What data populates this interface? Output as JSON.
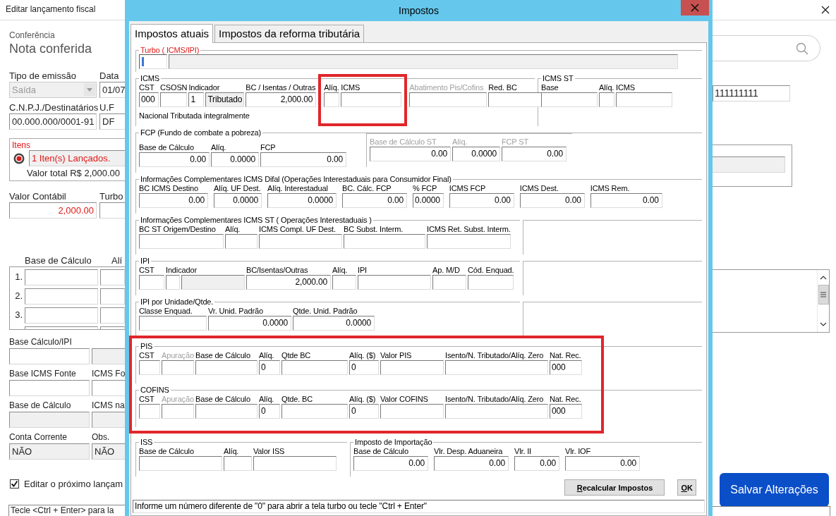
{
  "main_window": {
    "title": "Editar lançamento fiscal",
    "caption": "Conferência",
    "heading": "Nota conferida",
    "left_blocks": [
      {
        "kind": "fields",
        "fields": [
          {
            "label": "Tipo de emissão",
            "value": "Saída",
            "kind": "select"
          },
          {
            "label": "Data",
            "value": "01/07",
            "kind": "edit"
          }
        ]
      },
      {
        "kind": "fields",
        "fields": [
          {
            "label": "C.N.P.J./Destinatários",
            "value": "00.000.000/0001-91",
            "kind": "edit"
          },
          {
            "label": "U.F",
            "value": "DF",
            "kind": "edit"
          }
        ]
      },
      {
        "kind": "items",
        "title": "Itens",
        "summary": "1 Iten(s) Lançados.",
        "total": "Valor total R$ 2,000.00"
      },
      {
        "kind": "fields",
        "fields": [
          {
            "label": "Valor Contábil",
            "value": "2,000.00",
            "kind": "alert"
          },
          {
            "label": "Turbo",
            "kind": "edit"
          }
        ]
      },
      {
        "kind": "grid",
        "columns": [
          "Base de Cálculo",
          "Alí"
        ],
        "rows": [
          "1.",
          "2.",
          "3."
        ]
      },
      {
        "kind": "fields",
        "fields": [
          {
            "label": "Base Cálculo/IPI",
            "kind": "edit"
          },
          {
            "kind": "readonly"
          }
        ]
      },
      {
        "kind": "fields",
        "fields": [
          {
            "label": "Base ICMS Fonte",
            "kind": "edit"
          },
          {
            "label": "ICMS Fo",
            "kind": "edit"
          }
        ]
      },
      {
        "kind": "fields",
        "fields": [
          {
            "label": "Base de Cálculo",
            "kind": "readonly"
          },
          {
            "label": "ICMS na",
            "kind": "readonly"
          }
        ]
      },
      {
        "kind": "fields",
        "fields": [
          {
            "label": "Conta Corrente",
            "value": "NÃO",
            "kind": "readonly"
          },
          {
            "label": "Obs.",
            "value": "NÃO",
            "kind": "readonly"
          }
        ]
      }
    ],
    "next_entry": {
      "label": "Editar o próximo lançam",
      "checked": true
    },
    "hint": "Tecle <Ctrl + Enter> para la",
    "record_value": "111111111",
    "save_button": "Salvar Alterações"
  },
  "dialog": {
    "title": "Impostos",
    "tabs": [
      {
        "label": "Impostos atuais",
        "selected": true
      },
      {
        "label": "Impostos da reforma tributária",
        "selected": false
      }
    ],
    "rows": [
      {
        "highlighted": false,
        "groups": [
          {
            "kind": "turbo",
            "title": "Turbo ( ICMS/IPI)",
            "columns": [
              {
                "inputs": [
                  {
                    "kind": "focused"
                  },
                  {
                    "kind": "readonly"
                  }
                ]
              }
            ]
          }
        ]
      },
      {
        "highlighted": false,
        "groups": [
          {
            "kind": "icms",
            "title": "ICMS",
            "note": "Nacional Tributada integralmente",
            "columns": [
              {
                "label": "CST",
                "value": "000",
                "kind": "edit",
                "highlighted": false
              },
              {
                "label": "CSOSN",
                "kind": "edit",
                "highlighted": false
              },
              {
                "label": "Indicador",
                "inputs": [
                  {
                    "value": "1",
                    "kind": "edit"
                  },
                  {
                    "value": "Tributado",
                    "kind": "readonly"
                  }
                ],
                "highlighted": false
              },
              {
                "label": "BC / Isentas / Outras",
                "value": "2,000.00",
                "kind": "amount",
                "highlighted": false
              },
              {
                "label": "Alíq.",
                "kind": "edit",
                "highlighted": true
              },
              {
                "label": "ICMS",
                "kind": "edit",
                "highlighted": true
              },
              {
                "label": "Abatimento Pis/Cofins",
                "kind": "edit",
                "disabled": true,
                "highlighted": false
              },
              {
                "label": "Red. BC",
                "kind": "edit",
                "highlighted": false
              }
            ]
          },
          {
            "kind": "icms_st",
            "title": "ICMS ST",
            "columns": [
              {
                "label": "Base",
                "kind": "edit"
              },
              {
                "label": "Alíq.",
                "kind": "edit"
              },
              {
                "label": "ICMS",
                "kind": "edit"
              }
            ]
          }
        ]
      },
      {
        "highlighted": false,
        "groups": [
          {
            "kind": "fcp",
            "title": "FCP (Fundo de combate a pobreza)",
            "columns": [
              {
                "label": "Base de Cálculo",
                "value": "0.00",
                "kind": "amount"
              },
              {
                "label": "Alíq.",
                "value": "0.0000",
                "kind": "amount"
              },
              {
                "label": "FCP",
                "value": "0.00",
                "kind": "amount"
              }
            ],
            "subgroup": {
              "disabled": true,
              "columns": [
                {
                  "label": "Base de Cálculo ST",
                  "value": "0.00",
                  "kind": "amount"
                },
                {
                  "label": "Alíq.",
                  "value": "0.0000",
                  "kind": "amount"
                },
                {
                  "label": "FCP ST",
                  "value": "0.00",
                  "kind": "amount"
                }
              ]
            }
          }
        ]
      },
      {
        "highlighted": false,
        "groups": [
          {
            "kind": "difal",
            "title": "Informações Complementares ICMS Difal (Operações Interestaduais para Consumidor Final)",
            "columns": [
              {
                "label": "BC ICMS Destino",
                "value": "0.00",
                "kind": "amount"
              },
              {
                "label": "Alíq. UF Dest.",
                "value": "0.0000",
                "kind": "amount"
              },
              {
                "label": "Alíq. Interestadual",
                "value": "0.0000",
                "kind": "amount"
              },
              {
                "label": "BC. Cálc. FCP",
                "value": "0.00",
                "kind": "amount"
              },
              {
                "label": "% FCP",
                "value": "0.0000",
                "kind": "amount"
              },
              {
                "label": "ICMS FCP",
                "value": "0.00",
                "kind": "amount"
              },
              {
                "label": "ICMS Dest.",
                "value": "0.00",
                "kind": "amount"
              },
              {
                "label": "ICMS Rem.",
                "value": "0.00",
                "kind": "amount"
              }
            ]
          }
        ]
      },
      {
        "highlighted": false,
        "groups": [
          {
            "kind": "icms_st_comp",
            "title": "Informações Complementares ICMS ST ( Operações Interestaduais )",
            "columns": [
              {
                "label": "BC ST Origem/Destino",
                "kind": "edit"
              },
              {
                "label": "Alíq.",
                "kind": "edit"
              },
              {
                "label": "ICMS Compl. UF Dest.",
                "kind": "edit"
              },
              {
                "label": "BC  Subst. Interm.",
                "kind": "edit"
              },
              {
                "label": "ICMS Ret. Subst. Interm.",
                "kind": "edit"
              }
            ]
          },
          {
            "kind": "blank"
          }
        ]
      },
      {
        "highlighted": false,
        "groups": [
          {
            "kind": "ipi",
            "title": "IPI",
            "columns": [
              {
                "label": "CST",
                "kind": "edit"
              },
              {
                "label": "Indicador",
                "inputs": [
                  {
                    "kind": "edit"
                  },
                  {
                    "kind": "readonly"
                  }
                ]
              },
              {
                "label": "BC/Isentas/Outras",
                "value": "2,000.00",
                "kind": "amount"
              },
              {
                "label": "Alíq.",
                "kind": "edit"
              },
              {
                "label": "IPI",
                "kind": "edit"
              },
              {
                "label": "Ap. M/D",
                "kind": "edit"
              },
              {
                "label": "Cód. Enquad.",
                "kind": "edit"
              }
            ]
          },
          {
            "kind": "blank"
          }
        ]
      },
      {
        "highlighted": false,
        "groups": [
          {
            "kind": "ipi_qty",
            "title": "IPI por Unidade/Qtde.",
            "columns": [
              {
                "label": "Classe Enquad.",
                "kind": "edit"
              },
              {
                "label": "Vr. Unid. Padrão",
                "value": "0.0000",
                "kind": "amount"
              },
              {
                "label": "Qtde. Unid. Padrão",
                "value": "0.0000",
                "kind": "amount"
              }
            ]
          },
          {
            "kind": "blank"
          }
        ]
      },
      {
        "highlighted": true,
        "groups": [
          {
            "kind": "pis",
            "title": "PIS",
            "columns": [
              {
                "label": "CST",
                "kind": "edit"
              },
              {
                "label": "Apuração",
                "kind": "edit",
                "disabled": true
              },
              {
                "label": "Base de Cálculo",
                "kind": "edit"
              },
              {
                "label": "Alíq.",
                "value": "0",
                "kind": "edit"
              },
              {
                "label": "Qtde BC",
                "kind": "edit"
              },
              {
                "label": "Alíq. ($)",
                "value": "0",
                "kind": "edit"
              },
              {
                "label": "Valor PIS",
                "kind": "edit"
              },
              {
                "label": "Isento/N. Tributado/Alíq. Zero",
                "kind": "edit"
              },
              {
                "label": "Nat. Rec.",
                "value": "000",
                "kind": "edit"
              }
            ]
          }
        ]
      },
      {
        "highlighted": true,
        "groups": [
          {
            "kind": "cofins",
            "title": "COFINS",
            "columns": [
              {
                "label": "CST",
                "kind": "edit"
              },
              {
                "label": "Apuração",
                "kind": "edit",
                "disabled": true
              },
              {
                "label": "Base de Cálculo",
                "kind": "edit"
              },
              {
                "label": "Alíq.",
                "value": "0",
                "kind": "edit"
              },
              {
                "label": "Qtde. BC",
                "kind": "edit"
              },
              {
                "label": "Alíq. ($)",
                "value": "0",
                "kind": "edit"
              },
              {
                "label": "Valor COFINS",
                "kind": "edit"
              },
              {
                "label": "Isento/N. Tributado/Alíq. Zero",
                "kind": "edit"
              },
              {
                "label": "Nat. Rec.",
                "value": "000",
                "kind": "edit"
              }
            ]
          }
        ]
      },
      {
        "highlighted": false,
        "groups": [
          {
            "kind": "iss",
            "title": "ISS",
            "columns": [
              {
                "label": "Base de Cálculo",
                "kind": "edit"
              },
              {
                "label": "Alíq.",
                "kind": "edit"
              },
              {
                "label": "Valor ISS",
                "kind": "edit"
              }
            ]
          },
          {
            "kind": "import",
            "title": "Imposto de Importação",
            "columns": [
              {
                "label": "Base de Cálculo",
                "value": "0.00",
                "kind": "amount"
              },
              {
                "label": "Vlr. Desp. Aduaneira",
                "value": "0.00",
                "kind": "amount"
              },
              {
                "label": "Vlr. II",
                "value": "0.00",
                "kind": "amount"
              },
              {
                "label": "Vlr. IOF",
                "value": "0.00",
                "kind": "amount"
              }
            ]
          }
        ]
      }
    ],
    "buttons": [
      {
        "label": "Recalcular Impostos"
      },
      {
        "label": "OK"
      }
    ],
    "status": "Informe um número diferente de \"0\" para abrir a tela turbo ou tecle \"Ctrl + Enter\""
  }
}
